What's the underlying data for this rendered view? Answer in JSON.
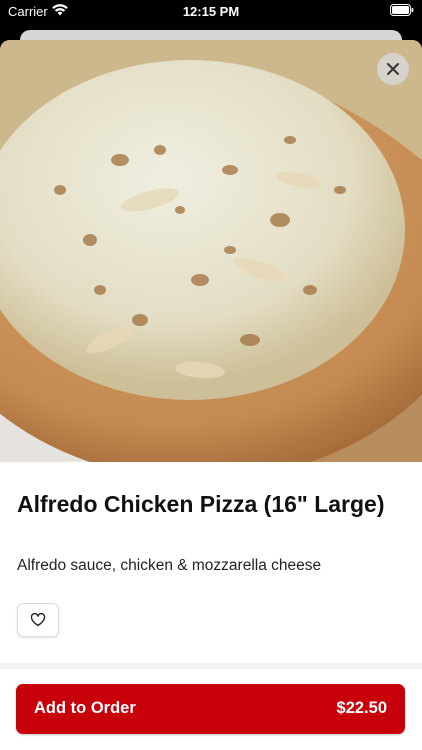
{
  "status_bar": {
    "carrier": "Carrier",
    "time": "12:15 PM"
  },
  "item": {
    "image_description_icon": "pizza-photo",
    "title": "Alfredo Chicken Pizza (16\" Large)",
    "description": "Alfredo sauce, chicken & mozzarella cheese"
  },
  "actions": {
    "close_icon": "close-icon",
    "favorite_icon": "heart-icon",
    "add_to_order_label": "Add to Order",
    "price": "$22.50"
  },
  "colors": {
    "accent": "#c8000a"
  }
}
